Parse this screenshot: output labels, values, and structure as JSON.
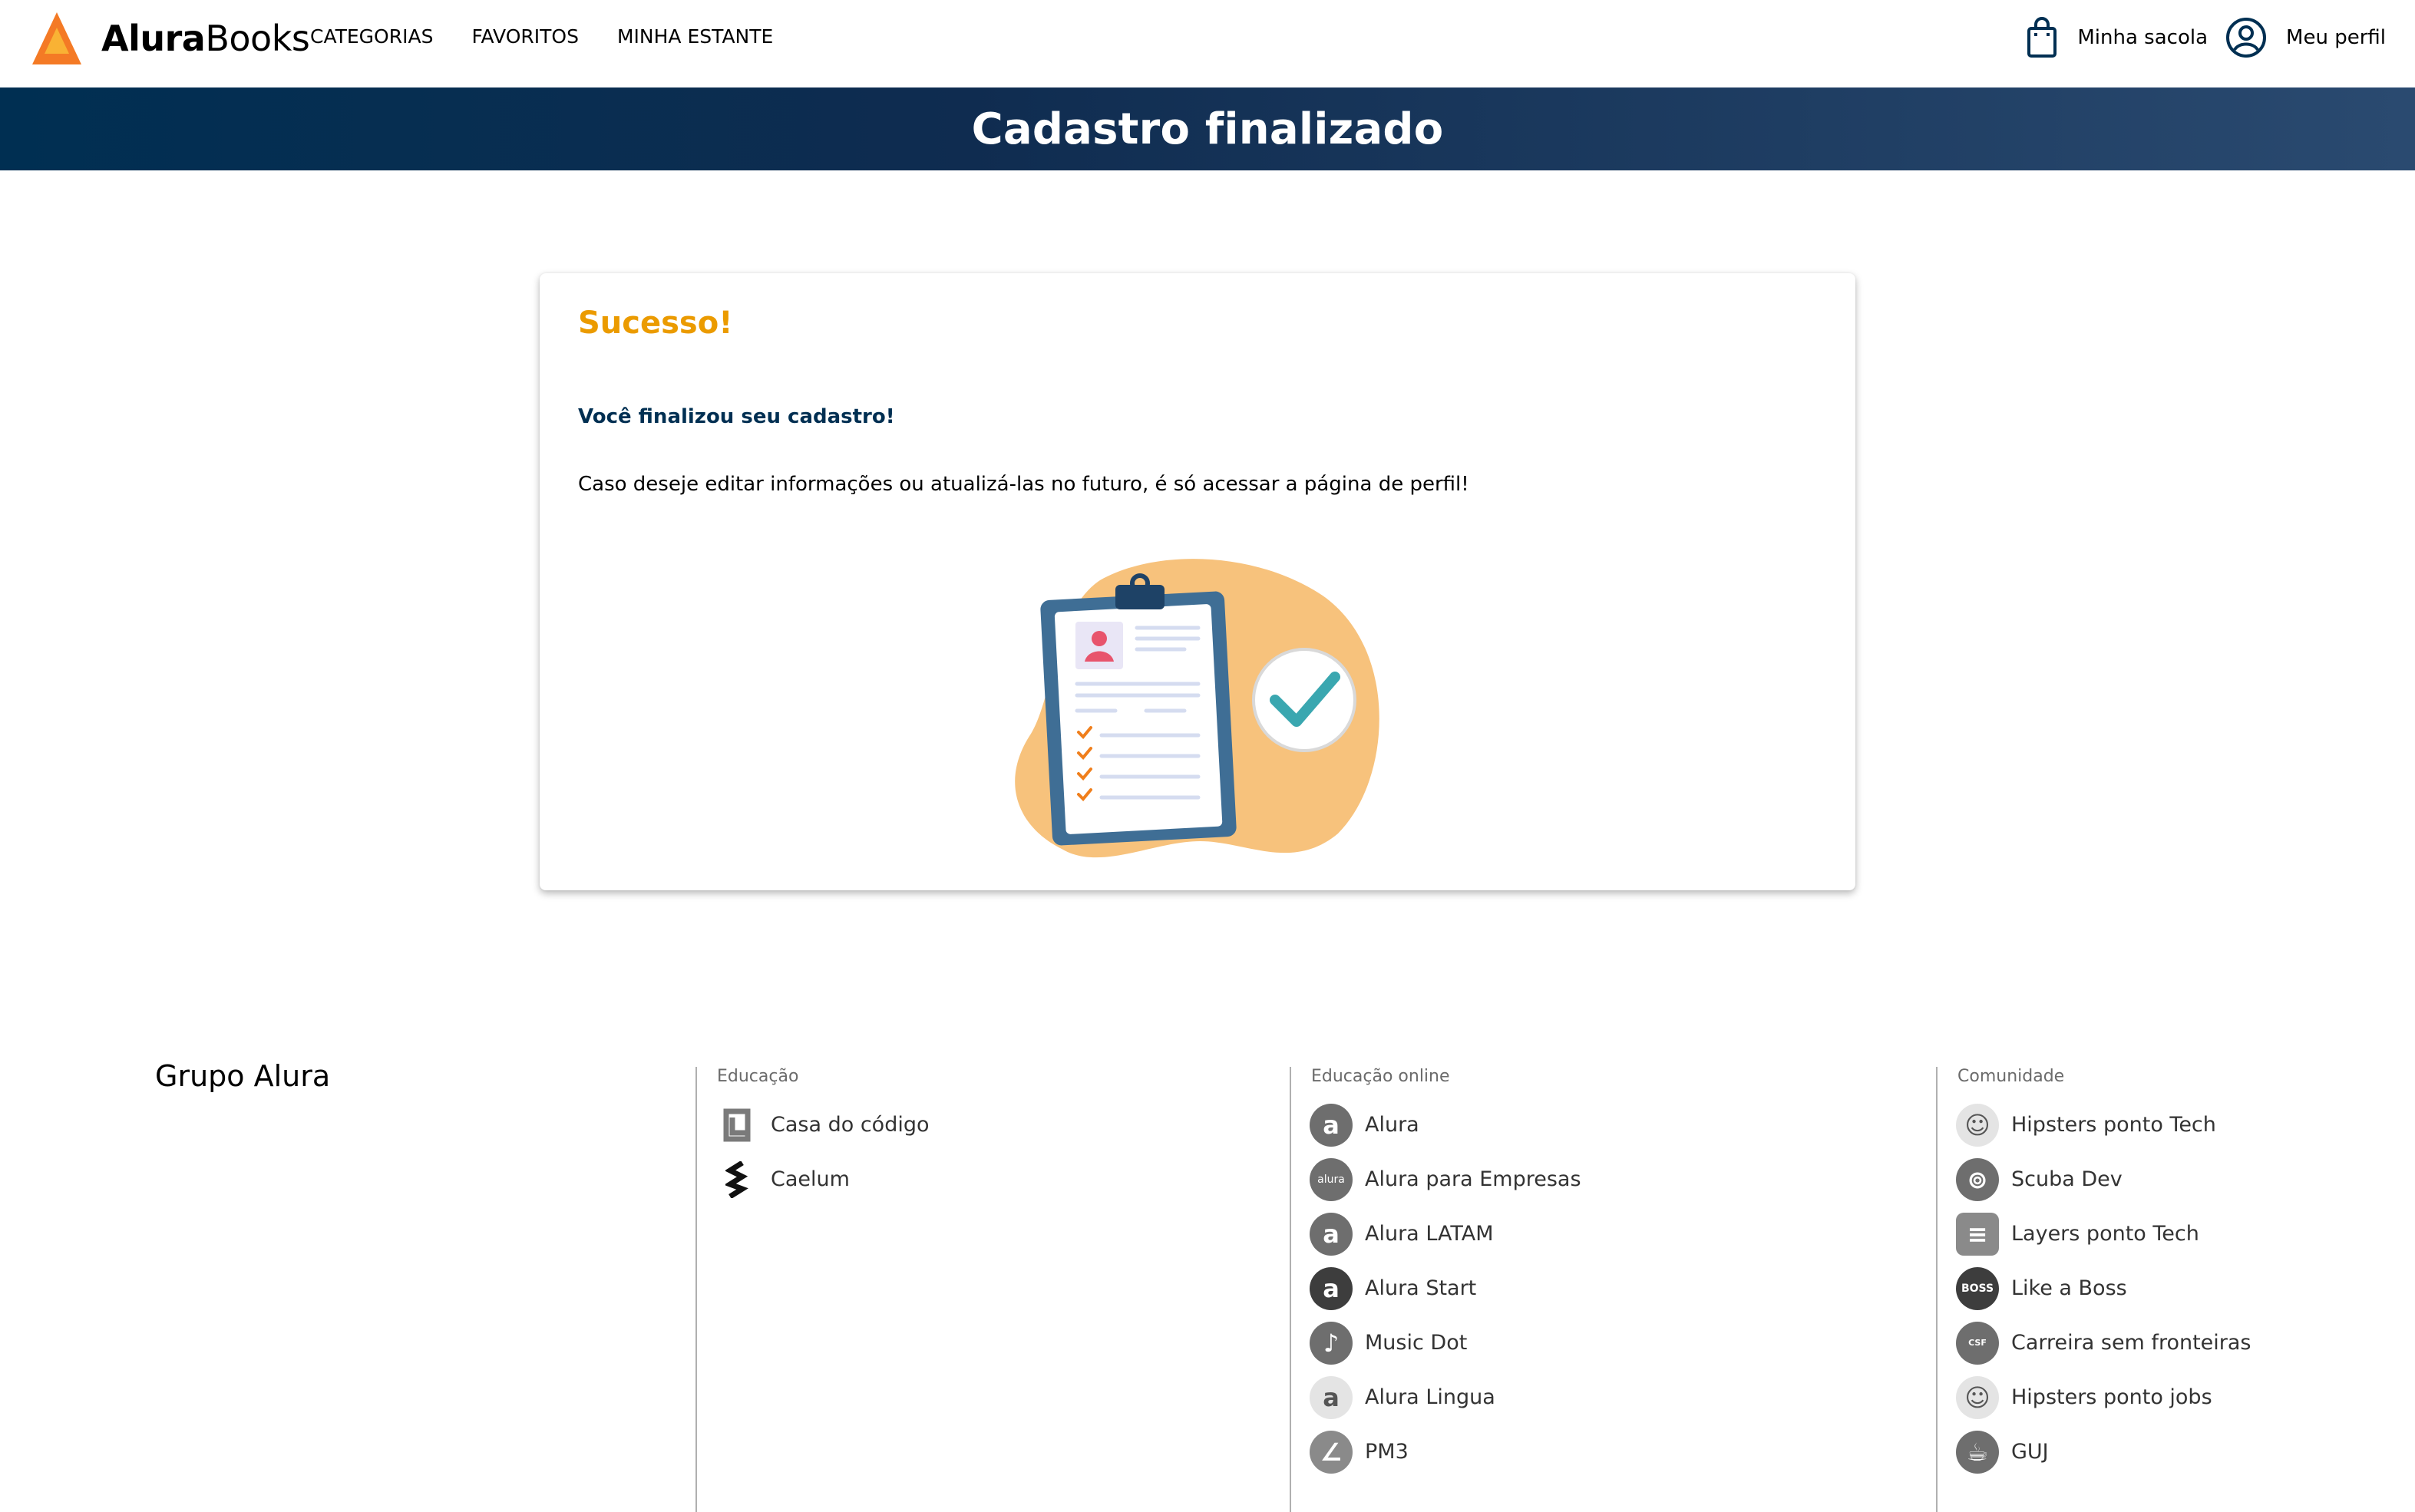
{
  "header": {
    "brand_bold": "Alura",
    "brand_rest": "Books",
    "nav": [
      {
        "label": "CATEGORIAS"
      },
      {
        "label": "FAVORITOS"
      },
      {
        "label": "MINHA ESTANTE"
      }
    ],
    "bag_label": "Minha sacola",
    "profile_label": "Meu perfil"
  },
  "banner": {
    "title": "Cadastro finalizado"
  },
  "card": {
    "title": "Sucesso!",
    "subtitle": "Você finalizou seu cadastro!",
    "text": "Caso deseje editar informações ou atualizá-las no futuro, é só acessar a página de perfil!"
  },
  "footer": {
    "brand": "Grupo Alura",
    "education": {
      "title": "Educação",
      "items": [
        {
          "label": "Casa do código",
          "icon": "casa-do-codigo-icon"
        },
        {
          "label": "Caelum",
          "icon": "caelum-icon"
        }
      ]
    },
    "online": {
      "title": "Educação online",
      "items": [
        {
          "label": "Alura",
          "icon": "alura-icon"
        },
        {
          "label": "Alura para Empresas",
          "icon": "alura-empresas-icon"
        },
        {
          "label": "Alura LATAM",
          "icon": "alura-latam-icon"
        },
        {
          "label": "Alura Start",
          "icon": "alura-start-icon"
        },
        {
          "label": "Music Dot",
          "icon": "music-dot-icon"
        },
        {
          "label": "Alura Lingua",
          "icon": "alura-lingua-icon"
        },
        {
          "label": "PM3",
          "icon": "pm3-icon"
        }
      ]
    },
    "community": {
      "title": "Comunidade",
      "items": [
        {
          "label": "Hipsters ponto Tech",
          "icon": "hipsters-tech-icon"
        },
        {
          "label": "Scuba Dev",
          "icon": "scuba-dev-icon"
        },
        {
          "label": "Layers ponto Tech",
          "icon": "layers-tech-icon"
        },
        {
          "label": "Like a Boss",
          "icon": "like-a-boss-icon"
        },
        {
          "label": "Carreira sem fronteiras",
          "icon": "carreira-sem-fronteiras-icon"
        },
        {
          "label": "Hipsters ponto jobs",
          "icon": "hipsters-jobs-icon"
        },
        {
          "label": "GUJ",
          "icon": "guj-icon"
        }
      ]
    }
  },
  "colors": {
    "accent_orange": "#eb9b00",
    "navy": "#002f52",
    "blob": "#f7c27c",
    "check_teal": "#3aa7b0"
  }
}
